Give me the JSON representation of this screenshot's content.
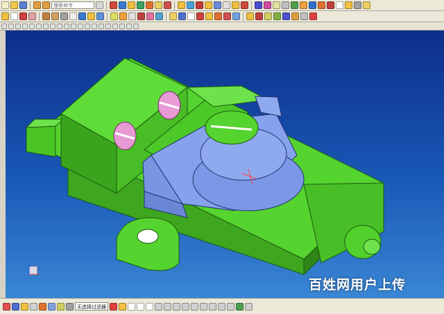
{
  "toolbar": {
    "search_placeholder": "搜索命令"
  },
  "selection_bar": {
    "filter_value": "无选择过滤器"
  },
  "watermark": {
    "text": "百姓网用户上传"
  },
  "colors": {
    "base_green": "#52d12c",
    "clamp_blue": "#7b98e6",
    "screw_pink": "#e89ad4",
    "viewport_top": "#0d2e8a",
    "viewport_bottom": "#3a86d4"
  },
  "icons": [
    "new-file-icon",
    "open-folder-icon",
    "save-icon",
    "undo-icon",
    "redo-icon",
    "cut-icon",
    "copy-icon",
    "paste-icon",
    "sketch-icon",
    "extrude-icon",
    "revolve-icon",
    "hole-icon",
    "blend-icon",
    "chamfer-icon",
    "shell-icon",
    "pattern-icon",
    "mirror-icon",
    "measure-icon",
    "analysis-icon",
    "view-icon",
    "zoom-icon",
    "rotate-icon",
    "pan-icon",
    "layer-icon",
    "color-icon",
    "help-icon"
  ]
}
